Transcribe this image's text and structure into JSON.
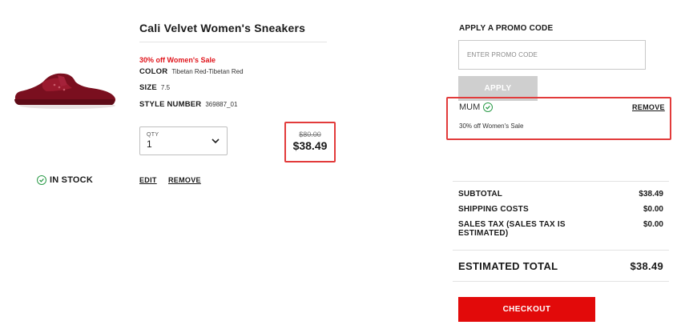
{
  "product": {
    "title": "Cali Velvet Women's Sneakers",
    "sale_label": "30% off Women's Sale",
    "color_label": "COLOR",
    "color_value": "Tibetan Red-Tibetan Red",
    "size_label": "SIZE",
    "size_value": "7.5",
    "style_label": "STYLE NUMBER",
    "style_value": "369887_01",
    "qty_label": "QTY",
    "qty_value": "1",
    "price_old": "$80.00",
    "price_new": "$38.49",
    "stock": "IN STOCK",
    "edit_label": "EDIT",
    "remove_label": "REMOVE",
    "image_icon": "sneaker-image"
  },
  "promo": {
    "heading": "APPLY A PROMO CODE",
    "placeholder": "ENTER PROMO CODE",
    "apply_label": "APPLY",
    "applied_code": "MUM",
    "applied_desc": "30% off Women's Sale",
    "remove_label": "REMOVE"
  },
  "summary": {
    "subtotal_label": "SUBTOTAL",
    "subtotal_value": "$38.49",
    "shipping_label": "SHIPPING COSTS",
    "shipping_value": "$0.00",
    "tax_label": "SALES TAX (SALES TAX IS ESTIMATED)",
    "tax_value": "$0.00",
    "total_label": "ESTIMATED TOTAL",
    "total_value": "$38.49",
    "checkout_label": "CHECKOUT"
  },
  "colors": {
    "accent_red": "#e20a0a",
    "sale_red": "#e0141b",
    "highlight_red": "#e23b3b",
    "stock_green": "#2d9c4a",
    "disabled_gray": "#cfcfcf"
  }
}
